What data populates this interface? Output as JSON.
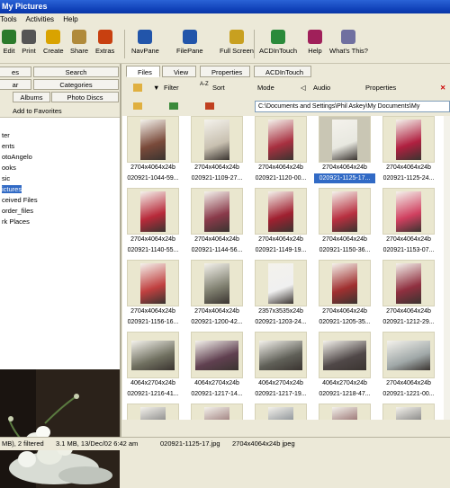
{
  "window": {
    "title": "My Pictures"
  },
  "menu": [
    "Tools",
    "Activities",
    "Help"
  ],
  "toolbar": [
    {
      "label": "Edit",
      "icon": "edit-icon",
      "color": "#2b7a2b"
    },
    {
      "label": "Print",
      "icon": "print-icon",
      "color": "#555555"
    },
    {
      "label": "Create",
      "icon": "create-icon",
      "color": "#d9a300"
    },
    {
      "label": "Share",
      "icon": "share-icon",
      "color": "#b08a3a"
    },
    {
      "label": "Extras",
      "icon": "extras-icon",
      "color": "#c84010"
    },
    {
      "label": "NavPane",
      "icon": "navpane-icon",
      "color": "#2255aa"
    },
    {
      "label": "FilePane",
      "icon": "filepane-icon",
      "color": "#2255aa"
    },
    {
      "label": "Full Screen",
      "icon": "fullscreen-icon",
      "color": "#c8a020"
    },
    {
      "label": "ACDInTouch",
      "icon": "acdintouch-icon",
      "color": "#2a8a3a"
    },
    {
      "label": "Help",
      "icon": "help-icon",
      "color": "#a0205a"
    },
    {
      "label": "What's This?",
      "icon": "whats-this-icon",
      "color": "#7070a0"
    }
  ],
  "left_tabs": [
    "es",
    "Search",
    "ar",
    "Categories",
    "Albums",
    "Photo Discs"
  ],
  "favorites": {
    "label": "Add to Favorites"
  },
  "tree": [
    "ter",
    "ents",
    "otoAngelo",
    "ooks",
    "sic",
    "ictures",
    "ceived Files",
    "order_files",
    "rk Places"
  ],
  "right_tabs": [
    "Files",
    "View",
    "Properties",
    "ACDInTouch"
  ],
  "right_toolbar": {
    "filter": "Filter",
    "sort": "Sort",
    "mode": "Mode",
    "audio": "Audio",
    "properties": "Properties",
    "sort_glyph": "A-Z"
  },
  "address": "C:\\Documents and Settings\\Phil Askey\\My Documents\\My",
  "thumbnails": [
    {
      "dims": "2704x4064x24b",
      "name": "020921-1044-59..."
    },
    {
      "dims": "2704x4064x24b",
      "name": "020921-1109-27..."
    },
    {
      "dims": "2704x4064x24b",
      "name": "020921-1120-00..."
    },
    {
      "dims": "2704x4064x24b",
      "name": "020921-1125-17..."
    },
    {
      "dims": "2704x4064x24b",
      "name": "020921-1125-24..."
    },
    {
      "dims": "2704x4064x24b",
      "name": "020921-1140-55..."
    },
    {
      "dims": "2704x4064x24b",
      "name": "020921-1144-56..."
    },
    {
      "dims": "2704x4064x24b",
      "name": "020921-1149-19..."
    },
    {
      "dims": "2704x4064x24b",
      "name": "020921-1150-36..."
    },
    {
      "dims": "2704x4064x24b",
      "name": "020921-1153-07..."
    },
    {
      "dims": "2704x4064x24b",
      "name": "020921-1156-16..."
    },
    {
      "dims": "2704x4064x24b",
      "name": "020921-1200-42..."
    },
    {
      "dims": "2357x3535x24b",
      "name": "020921-1203-24..."
    },
    {
      "dims": "2704x4064x24b",
      "name": "020921-1205-35..."
    },
    {
      "dims": "2704x4064x24b",
      "name": "020921-1212-29..."
    },
    {
      "dims": "4064x2704x24b",
      "name": "020921-1216-41..."
    },
    {
      "dims": "4064x2704x24b",
      "name": "020921-1217-14..."
    },
    {
      "dims": "4064x2704x24b",
      "name": "020921-1217-19..."
    },
    {
      "dims": "4064x2704x24b",
      "name": "020921-1218-47..."
    },
    {
      "dims": "2704x4064x24b",
      "name": "020921-1221-00..."
    },
    {
      "dims": "",
      "name": ""
    },
    {
      "dims": "",
      "name": ""
    },
    {
      "dims": "",
      "name": ""
    },
    {
      "dims": "",
      "name": ""
    },
    {
      "dims": "",
      "name": ""
    }
  ],
  "status": {
    "count": "MB), 2 filtered",
    "size": "3.1 MB, 13/Dec/02 6:42 am",
    "file": "020921-1125-17.jpg",
    "info": "2704x4064x24b jpeg"
  }
}
